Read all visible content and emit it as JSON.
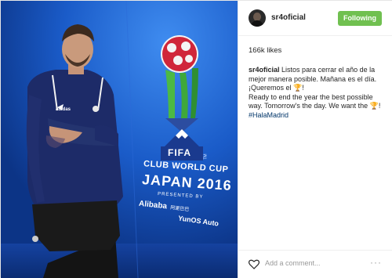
{
  "header": {
    "username": "sr4oficial",
    "follow_label": "Following",
    "follow_color": "#70c050"
  },
  "likes": "166k likes",
  "caption": {
    "user": "sr4oficial",
    "line1": "Listos para cerrar el año de la mejor manera posible. Mañana es el día. ¡Queremos el ",
    "trophy1": "🏆",
    "line1_end": "!",
    "line2": "Ready to end the year the best possible way. Tomorrow's the day. We want the ",
    "trophy2": "🏆",
    "line2_end": "!",
    "hashtag": "#HalaMadrid"
  },
  "photo": {
    "fifa_text": "FIFA",
    "tm": "TM",
    "event_line1": "CLUB WORLD CUP",
    "event_line2": "JAPAN 2016",
    "presented_by": "PRESENTED BY",
    "sponsor1": "Alibaba",
    "sponsor1_sub": "阿里巴巴",
    "sponsor2": "YunOS Auto",
    "adidas": "adidas"
  },
  "footer": {
    "comment_placeholder": "Add a comment...",
    "more": "···"
  },
  "icons": {
    "heart": "heart-icon",
    "more": "more-options-icon"
  }
}
